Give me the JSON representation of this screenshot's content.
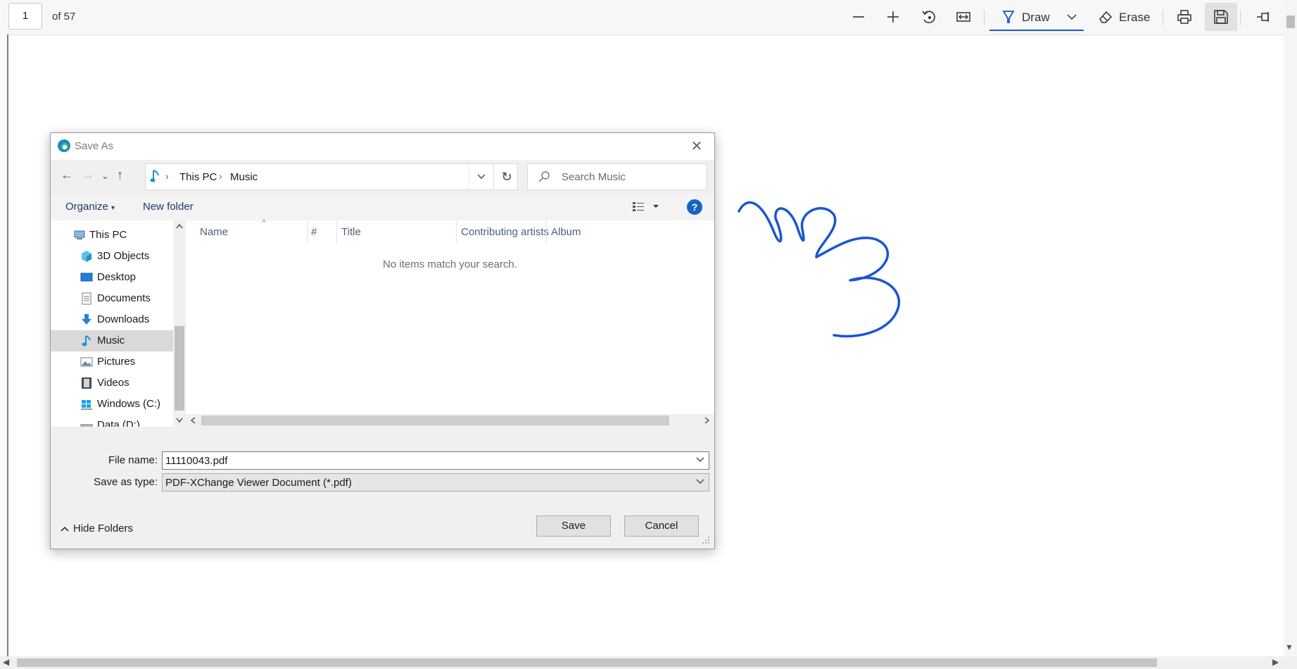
{
  "viewer": {
    "page_number": "1",
    "page_total": "of 57",
    "toolbar": {
      "zoom_out_icon": "minus-icon",
      "zoom_in_icon": "plus-icon",
      "rotate_icon": "rotate-icon",
      "fit_icon": "fit-width-icon",
      "draw_label": "Draw",
      "erase_label": "Erase",
      "print_icon": "print-icon",
      "save_icon": "save-icon",
      "pin_icon": "pin-icon"
    },
    "ink_color": "#1a56cf"
  },
  "dialog": {
    "title": "Save As",
    "address": {
      "crumbs": [
        "This PC",
        "Music"
      ]
    },
    "search_placeholder": "Search Music",
    "commands": {
      "organize": "Organize",
      "new_folder": "New folder"
    },
    "tree": [
      {
        "label": "This PC",
        "icon": "computer-icon"
      },
      {
        "label": "3D Objects",
        "icon": "cube-icon"
      },
      {
        "label": "Desktop",
        "icon": "desktop-icon"
      },
      {
        "label": "Documents",
        "icon": "document-icon"
      },
      {
        "label": "Downloads",
        "icon": "download-icon"
      },
      {
        "label": "Music",
        "icon": "music-icon",
        "selected": true
      },
      {
        "label": "Pictures",
        "icon": "picture-icon"
      },
      {
        "label": "Videos",
        "icon": "video-icon"
      },
      {
        "label": "Windows (C:)",
        "icon": "windows-drive-icon"
      },
      {
        "label": "Data (D:)",
        "icon": "drive-icon"
      }
    ],
    "columns": [
      "Name",
      "#",
      "Title",
      "Contributing artists",
      "Album"
    ],
    "empty_message": "No items match your search.",
    "file_name_label": "File name:",
    "file_name_value": "11110043.pdf",
    "save_type_label": "Save as type:",
    "save_type_value": "PDF-XChange Viewer Document (*.pdf)",
    "hide_folders": "Hide Folders",
    "save_button": "Save",
    "cancel_button": "Cancel"
  }
}
